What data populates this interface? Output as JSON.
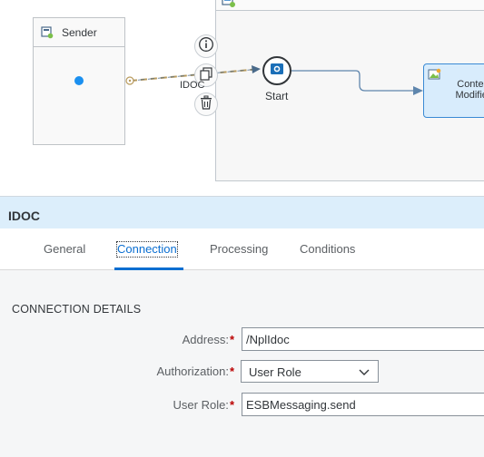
{
  "canvas": {
    "sender": {
      "label": "Sender"
    },
    "connection": {
      "label": "IDOC"
    },
    "start_event": {
      "label": "Start"
    },
    "content_modifier": {
      "label_line1": "Conten",
      "label_line2": "Modifier"
    },
    "icons": {
      "pool": "integration-process-icon",
      "sender": "sender-participant-icon",
      "info": "info-icon",
      "copy": "copy-icon",
      "delete": "trash-icon",
      "start": "message-start-icon",
      "content_modifier": "content-modifier-icon"
    },
    "colors": {
      "connection_dash": "#b89a5c",
      "flow": "#5f86ad",
      "dot": "#1b90f0",
      "selected_step": "#d8ecfc"
    }
  },
  "panel": {
    "title": "IDOC",
    "tabs": [
      {
        "label": "General"
      },
      {
        "label": "Connection"
      },
      {
        "label": "Processing"
      },
      {
        "label": "Conditions"
      }
    ],
    "active_tab": "Connection",
    "section_title": "CONNECTION DETAILS",
    "fields": {
      "address": {
        "label": "Address:",
        "value": "/NplIdoc"
      },
      "authorization": {
        "label": "Authorization:",
        "value": "User Role"
      },
      "user_role": {
        "label": "User Role:",
        "value": "ESBMessaging.send"
      }
    },
    "required_marker": "*",
    "colors": {
      "accent": "#0a6ed1",
      "header_bg": "#dceefb",
      "required": "#bb0000"
    }
  }
}
